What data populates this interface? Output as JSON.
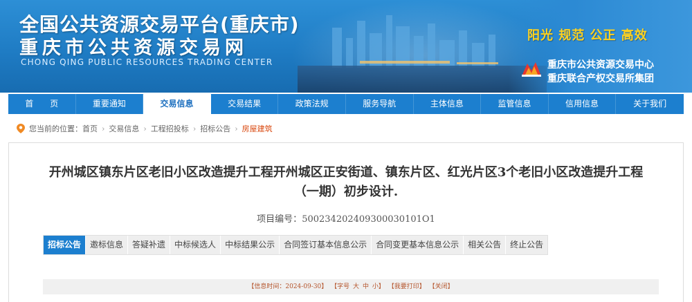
{
  "header": {
    "title_main": "全国公共资源交易平台(重庆市)",
    "title_sub": "重庆市公共资源交易网",
    "title_en": "CHONG QING PUBLIC RESOURCES TRADING CENTER",
    "slogan": "阳光  规范  公正  高效",
    "org_line1": "重庆市公共资源交易中心",
    "org_line2": "重庆联合产权交易所集团",
    "colors": {
      "banner": "#1f7cc4",
      "slogan": "#ffd21f"
    }
  },
  "nav": {
    "items": [
      {
        "label": "首　　页"
      },
      {
        "label": "重要通知"
      },
      {
        "label": "交易信息"
      },
      {
        "label": "交易结果"
      },
      {
        "label": "政策法规"
      },
      {
        "label": "服务导航"
      },
      {
        "label": "主体信息"
      },
      {
        "label": "监管信息"
      },
      {
        "label": "信用信息"
      },
      {
        "label": "关于我们"
      }
    ],
    "active": "交易信息"
  },
  "breadcrumb": {
    "prefix": "您当前的位置：",
    "items": [
      "首页",
      "交易信息",
      "工程招投标",
      "招标公告",
      "房屋建筑"
    ]
  },
  "article": {
    "title": "开州城区镇东片区老旧小区改造提升工程开州城区正安街道、镇东片区、红光片区3个老旧小区改造提升工程（一期）初步设计.",
    "project_code_label": "项目编号：",
    "project_code": "500234202409300030101O1"
  },
  "tabs": {
    "items": [
      "招标公告",
      "邀标信息",
      "答疑补遗",
      "中标候选人",
      "中标结果公示",
      "合同签订基本信息公示",
      "合同变更基本信息公示",
      "相关公告",
      "终止公告"
    ],
    "active": "招标公告"
  },
  "infobar": {
    "date_text": "【信息时间：2024-09-30】",
    "font_label": "【字号",
    "font_big": "大",
    "font_mid": "中",
    "font_small": "小】",
    "print": "【我要打印】",
    "close": "【关闭】"
  }
}
